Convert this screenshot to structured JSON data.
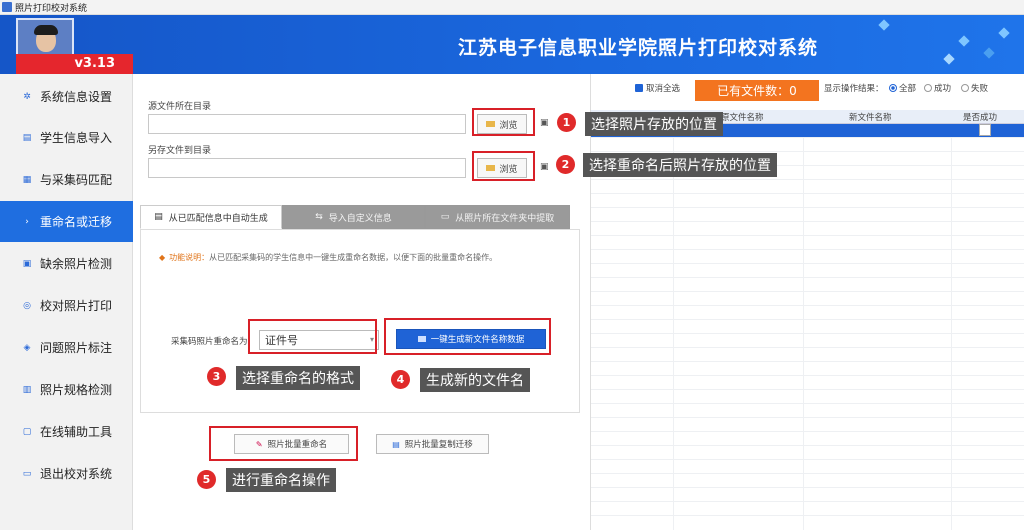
{
  "window": {
    "title": "照片打印校对系统"
  },
  "header": {
    "title": "江苏电子信息职业学院照片打印校对系统",
    "version": "v3.13"
  },
  "sidebar": {
    "items": [
      {
        "label": "系统信息设置",
        "icon": "gear-icon",
        "glyph": "✲"
      },
      {
        "label": "学生信息导入",
        "icon": "import-icon",
        "glyph": "▤"
      },
      {
        "label": "与采集码匹配",
        "icon": "match-icon",
        "glyph": "▦"
      },
      {
        "label": "重命名或迁移",
        "icon": "rename-icon",
        "glyph": "›",
        "active": true
      },
      {
        "label": "缺余照片检测",
        "icon": "check-icon",
        "glyph": "▣"
      },
      {
        "label": "校对照片打印",
        "icon": "print-icon",
        "glyph": "◎"
      },
      {
        "label": "问题照片标注",
        "icon": "mark-icon",
        "glyph": "◈"
      },
      {
        "label": "照片规格检测",
        "icon": "spec-icon",
        "glyph": "▥"
      },
      {
        "label": "在线辅助工具",
        "icon": "tools-icon",
        "glyph": "▢"
      },
      {
        "label": "退出校对系统",
        "icon": "exit-icon",
        "glyph": "▭"
      }
    ]
  },
  "main": {
    "source_label": "源文件所在目录",
    "source_value": "",
    "target_label": "另存文件到目录",
    "target_value": "",
    "browse_label": "浏览",
    "tabs": [
      {
        "label": "从已匹配信息中自动生成",
        "active": true
      },
      {
        "label": "导入自定义信息",
        "active": false
      },
      {
        "label": "从照片所在文件夹中提取",
        "active": false
      }
    ],
    "note_label": "功能说明：",
    "note_text": "从已匹配采集码的学生信息中一键生成重命名数据，以便下面的批量重命名操作。",
    "combo_label": "采集码照片重命名为",
    "combo_value": "证件号",
    "generate_label": "一键生成新文件名称数据",
    "rename_label": "照片批量重命名",
    "copy_label": "照片批量复制迁移"
  },
  "callouts": [
    {
      "num": "1",
      "text": "选择照片存放的位置"
    },
    {
      "num": "2",
      "text": "选择重命名后照片存放的位置"
    },
    {
      "num": "3",
      "text": "选择重命名的格式"
    },
    {
      "num": "4",
      "text": "生成新的文件名"
    },
    {
      "num": "5",
      "text": "进行重命名操作"
    }
  ],
  "right": {
    "cancel_all": "取消全选",
    "file_count": "已有文件数：0",
    "display_label": "显示操作结果：",
    "radio_all": "全部",
    "radio_success": "成功",
    "radio_fail": "失败",
    "col_old": "原文件名称",
    "col_new": "新文件名称",
    "col_status": "是否成功"
  },
  "colors": {
    "accent": "#1f63d6",
    "header": "#1a67dd",
    "badge": "#f3741f",
    "callout": "#e02a2a"
  }
}
